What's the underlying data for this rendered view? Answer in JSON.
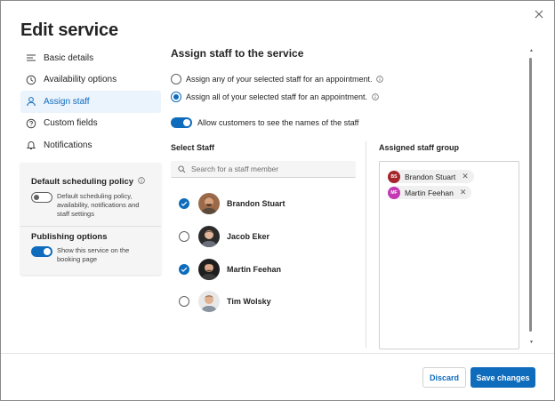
{
  "dialog": {
    "title": "Edit service",
    "close_icon": "close-icon"
  },
  "nav": {
    "items": [
      {
        "label": "Basic details",
        "icon": "list-icon"
      },
      {
        "label": "Availability options",
        "icon": "clock-icon"
      },
      {
        "label": "Assign staff",
        "icon": "person-icon",
        "active": true
      },
      {
        "label": "Custom fields",
        "icon": "help-circle-icon"
      },
      {
        "label": "Notifications",
        "icon": "bell-icon"
      }
    ]
  },
  "policy": {
    "title": "Default scheduling policy",
    "toggle_on": false,
    "description": "Default scheduling policy, availability, notifications and staff settings",
    "publishing_title": "Publishing options",
    "publishing_toggle_on": true,
    "publishing_description": "Show this service on the booking page"
  },
  "main": {
    "title": "Assign staff to the service",
    "radio_any": "Assign any of your selected staff for an appointment.",
    "radio_all": "Assign all of your selected staff for an appointment.",
    "selected_radio": "all",
    "allow_toggle_label": "Allow customers to see the names of the staff",
    "allow_toggle_on": true,
    "select_staff_heading": "Select Staff",
    "search_placeholder": "Search for a staff member",
    "assigned_heading": "Assigned staff group"
  },
  "staff": [
    {
      "name": "Brandon Stuart",
      "checked": true
    },
    {
      "name": "Jacob Eker",
      "checked": false
    },
    {
      "name": "Martin Feehan",
      "checked": true
    },
    {
      "name": "Tim Wolsky",
      "checked": false
    }
  ],
  "assigned": [
    {
      "initials": "BS",
      "name": "Brandon Stuart",
      "color": "#a4262c"
    },
    {
      "initials": "MF",
      "name": "Martin Feehan",
      "color": "#c239b3"
    }
  ],
  "footer": {
    "discard": "Discard",
    "save": "Save changes"
  },
  "colors": {
    "accent": "#0f6cbd"
  }
}
